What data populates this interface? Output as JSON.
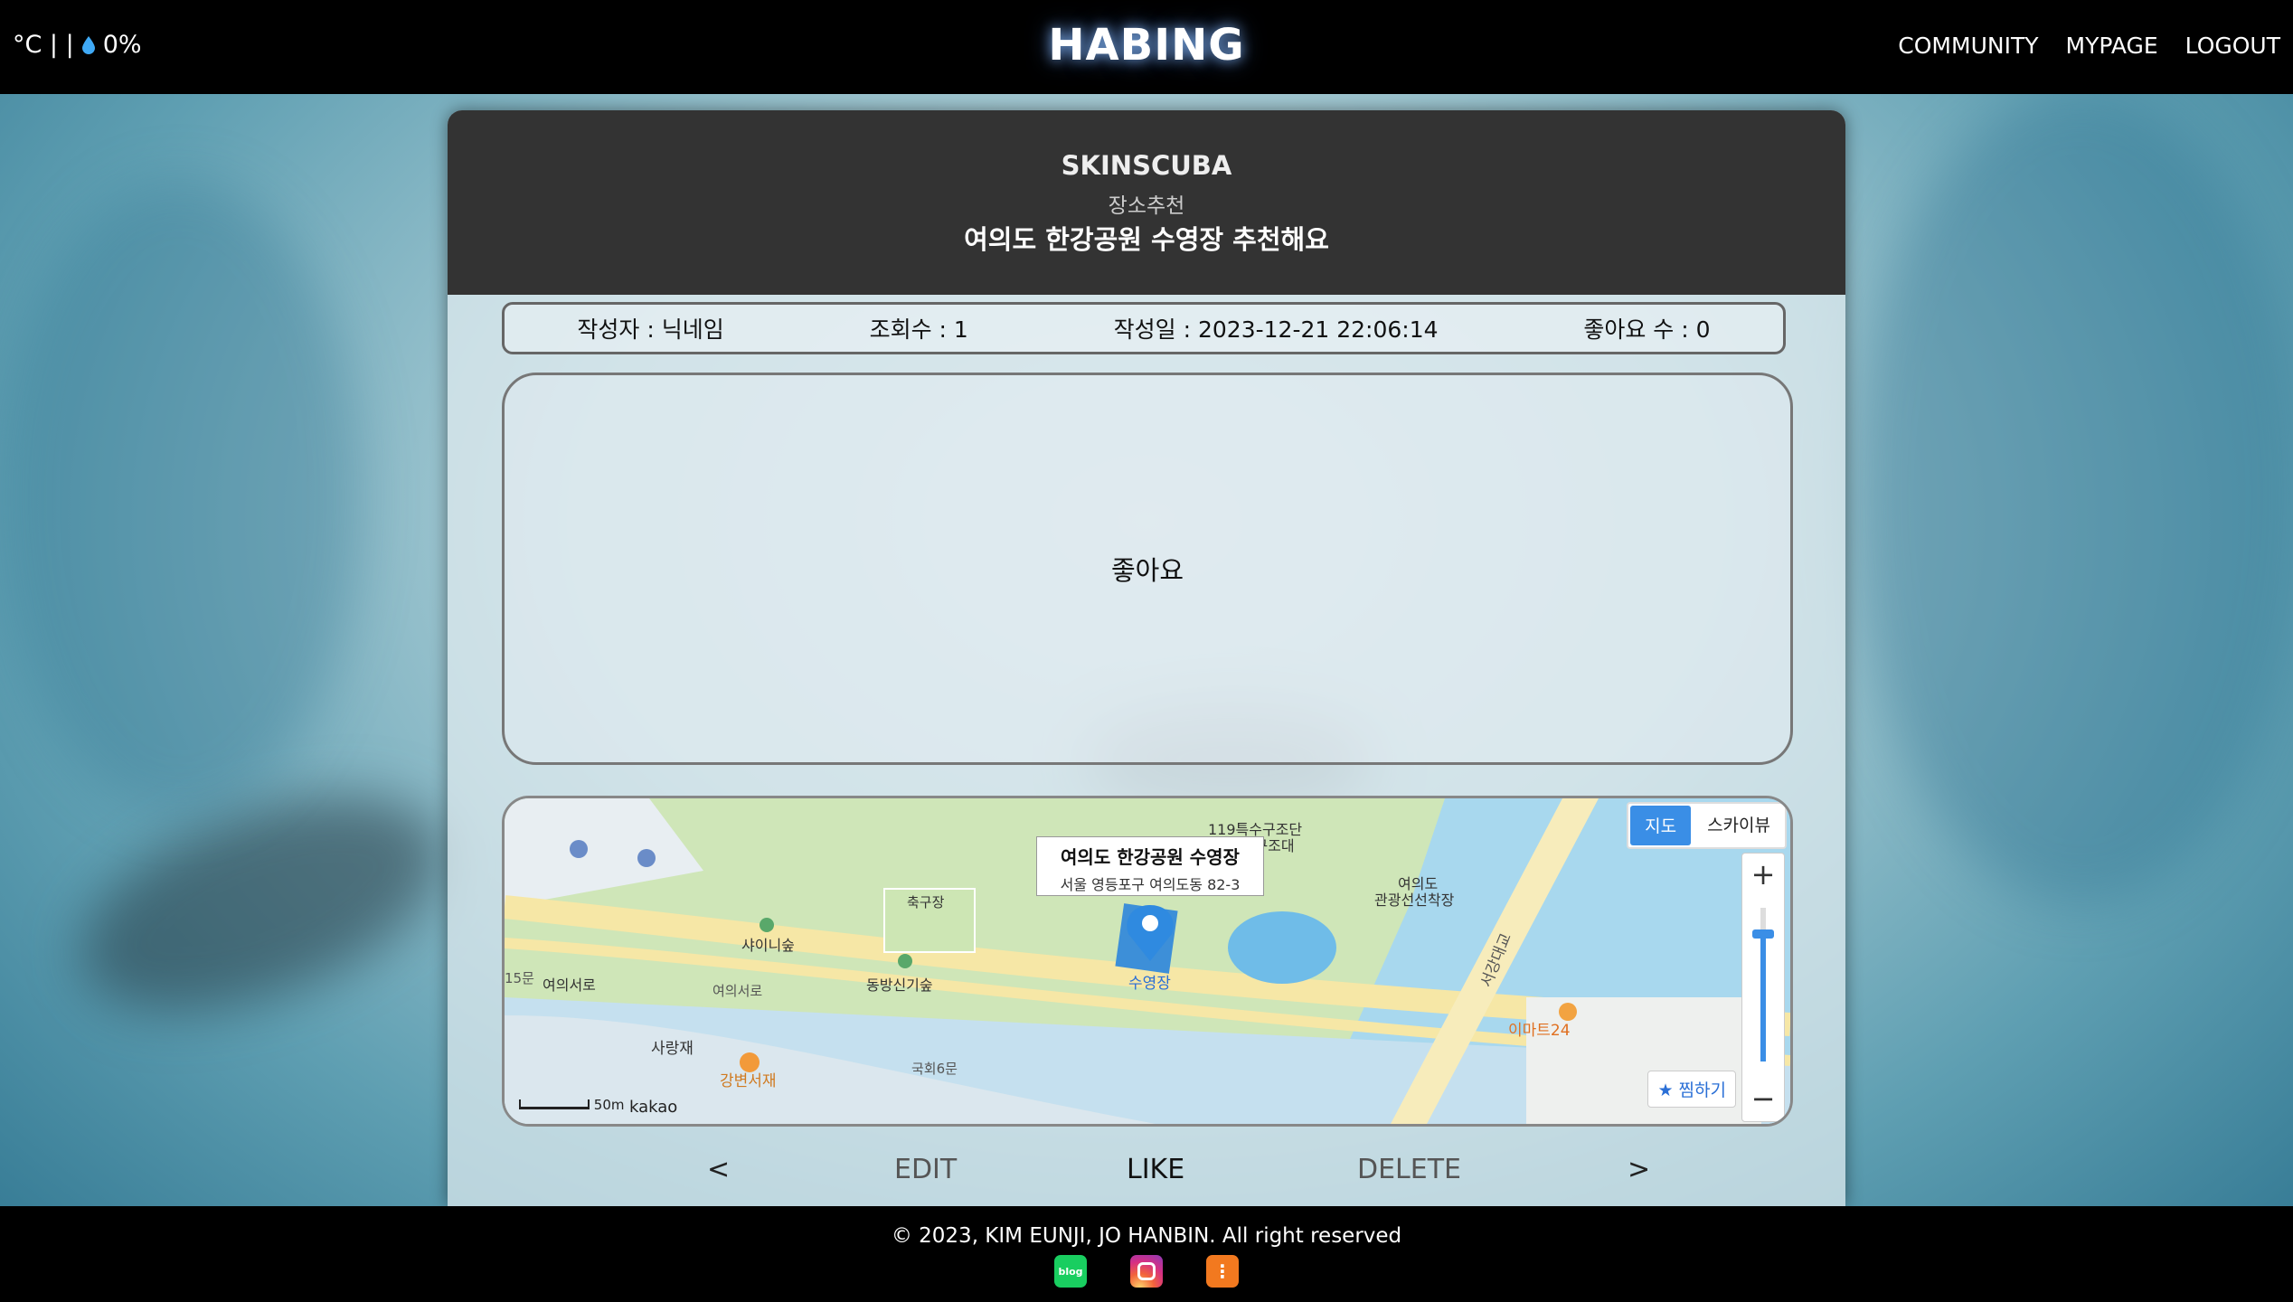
{
  "header": {
    "weather_text": "°C | |",
    "humidity": "0%",
    "brand": "HABING",
    "nav": [
      "COMMUNITY",
      "MYPAGE",
      "LOGOUT"
    ]
  },
  "post": {
    "category": "SKINSCUBA",
    "subcategory": "장소추천",
    "title": "여의도 한강공원 수영장 추천해요",
    "author": "작성자 : 닉네임",
    "views": "조회수 : 1",
    "date": "작성일 : 2023-12-21 22:06:14",
    "likes": "좋아요 수 : 0",
    "content": "좋아요"
  },
  "map": {
    "type_map": "지도",
    "type_sky": "스카이뷰",
    "zoom_in": "+",
    "zoom_out": "−",
    "favorite": "찜하기",
    "popup_title": "여의도 한강공원 수영장",
    "popup_address": "서울 영등포구 여의도동 82-3",
    "brand": "kakao",
    "scale": "50m",
    "labels": {
      "rescue": "119특수구조단",
      "rescue2": "수난구조대",
      "ferry": "여의도",
      "ferry2": "관광선선착장",
      "soccer": "축구장",
      "shiny": "샤이니숲",
      "dongbang": "동방신기숲",
      "street1": "여의서로",
      "street2": "여의서로",
      "sarangjae": "사랑재",
      "bookstore": "강변서재",
      "road": "국회6문",
      "pool": "수영장",
      "bridge": "서강대교",
      "emart": "이마트24",
      "num": "15문"
    }
  },
  "actions": {
    "prev": "<",
    "edit": "EDIT",
    "like": "LIKE",
    "delete": "DELETE",
    "next": ">"
  },
  "footer": {
    "copyright": "© 2023, KIM EUNJI, JO HANBIN. All right reserved",
    "icons": [
      "blog",
      "instagram",
      "tistory"
    ]
  },
  "colors": {
    "header_bg": "#000000",
    "card_head": "#333333",
    "accent_blue": "#3a8ee6"
  }
}
